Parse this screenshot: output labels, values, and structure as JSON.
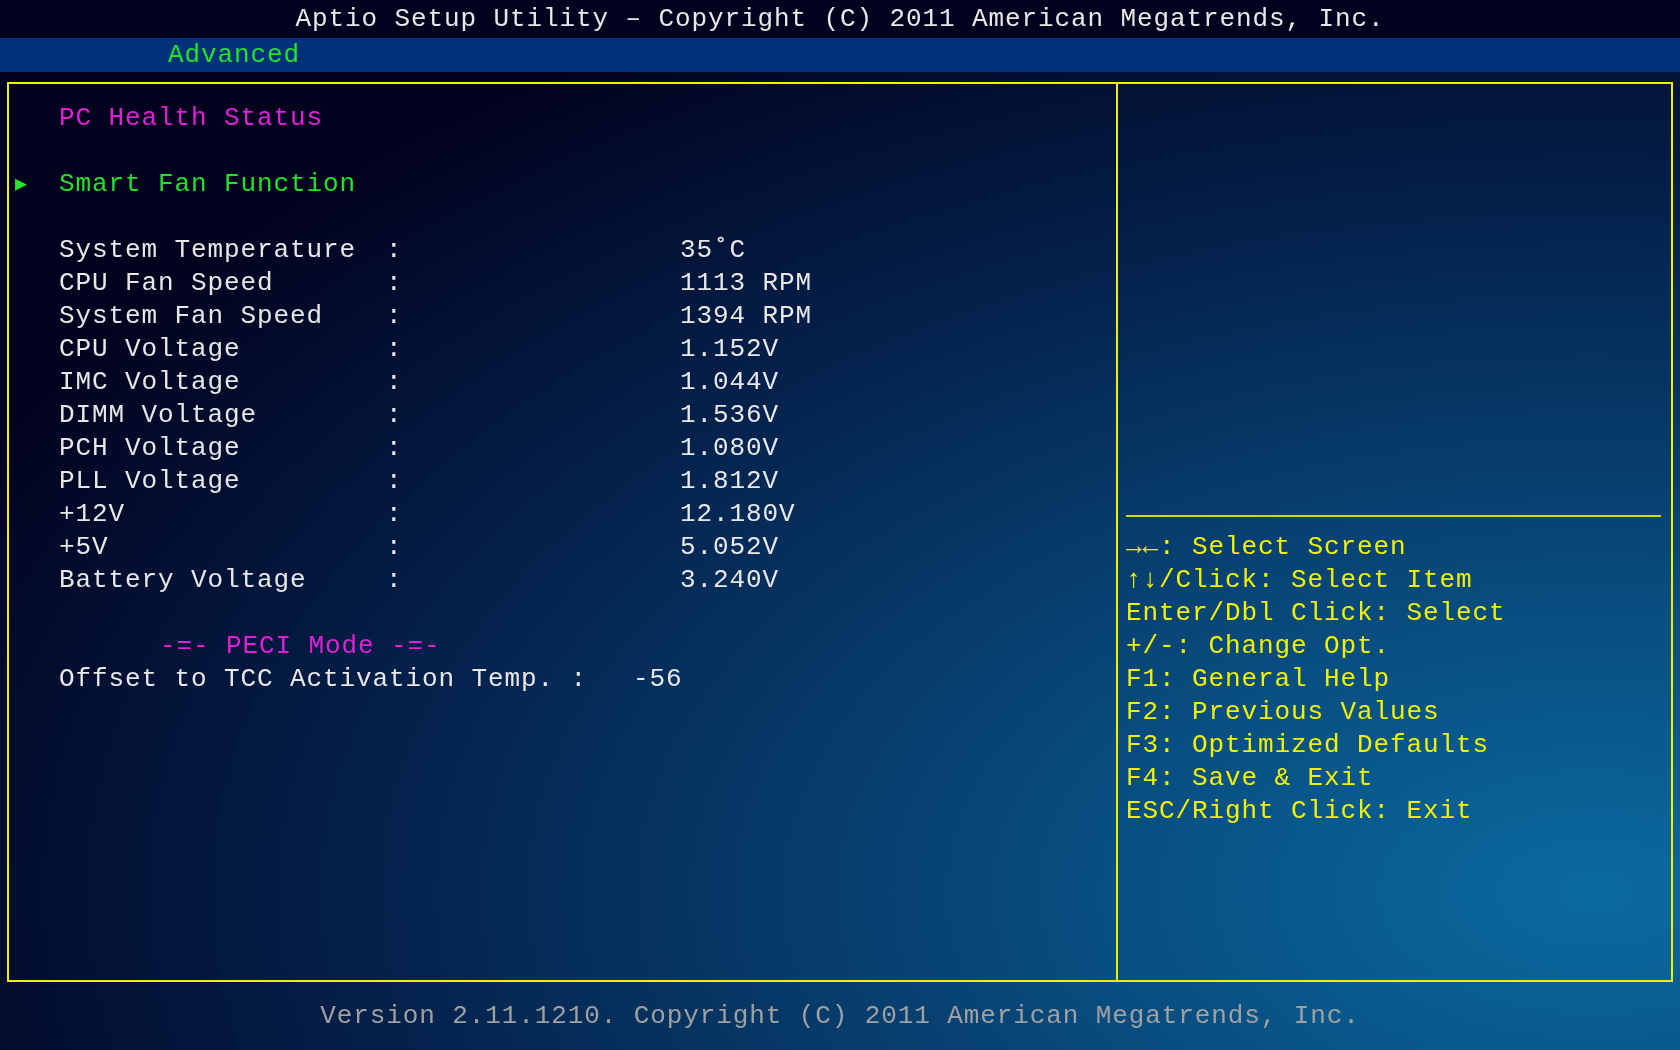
{
  "window": {
    "title": "Aptio Setup Utility – Copyright (C) 2011 American Megatrends, Inc."
  },
  "tabs": [
    {
      "label": "Advanced",
      "selected": true
    }
  ],
  "page_title": "PC Health Status",
  "submenus": [
    {
      "marker": "▶",
      "label": "Smart Fan Function"
    }
  ],
  "readings": [
    {
      "label": "System Temperature",
      "separator": ":",
      "value": "35˚C"
    },
    {
      "label": "CPU Fan Speed",
      "separator": ":",
      "value": "1113 RPM"
    },
    {
      "label": "System Fan Speed",
      "separator": ":",
      "value": "1394 RPM"
    },
    {
      "label": "CPU Voltage",
      "separator": ":",
      "value": "1.152V"
    },
    {
      "label": "IMC Voltage",
      "separator": ":",
      "value": "1.044V"
    },
    {
      "label": "DIMM Voltage",
      "separator": ":",
      "value": "1.536V"
    },
    {
      "label": "PCH Voltage",
      "separator": ":",
      "value": "1.080V"
    },
    {
      "label": "PLL Voltage",
      "separator": ":",
      "value": "1.812V"
    },
    {
      "label": "+12V",
      "separator": ":",
      "value": "12.180V"
    },
    {
      "label": "+5V",
      "separator": ":",
      "value": "5.052V"
    },
    {
      "label": "Battery Voltage",
      "separator": ":",
      "value": "3.240V"
    }
  ],
  "section_heading": "-=- PECI Mode -=-",
  "offset_row": {
    "label": "Offset to TCC Activation Temp. :",
    "value": "-56"
  },
  "help": [
    "→←: Select Screen",
    "↑↓/Click: Select Item",
    "Enter/Dbl Click: Select",
    "+/-: Change Opt.",
    "F1: General Help",
    "F2: Previous Values",
    "F3: Optimized Defaults",
    "F4: Save & Exit",
    "ESC/Right Click: Exit"
  ],
  "footer": "Version 2.11.1210. Copyright (C) 2011 American Megatrends, Inc."
}
